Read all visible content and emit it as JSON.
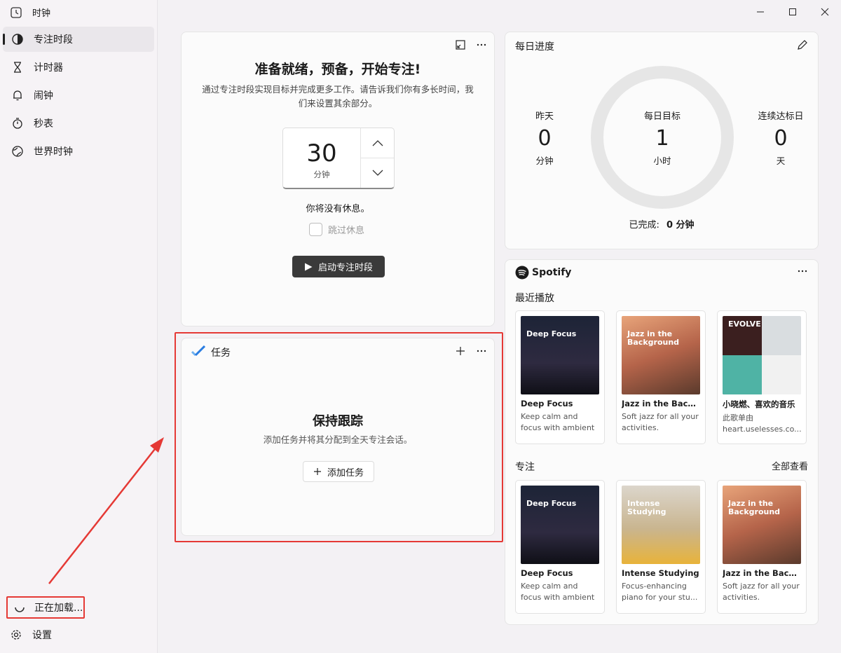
{
  "app": {
    "title": "时钟"
  },
  "sidebar": {
    "items": [
      {
        "label": "专注时段",
        "icon": "focus-icon",
        "active": true
      },
      {
        "label": "计时器",
        "icon": "hourglass-icon"
      },
      {
        "label": "闹钟",
        "icon": "bell-icon"
      },
      {
        "label": "秒表",
        "icon": "stopwatch-icon"
      },
      {
        "label": "世界时钟",
        "icon": "globe-icon"
      }
    ],
    "loading_label": "正在加载...",
    "settings_label": "设置"
  },
  "focus": {
    "title": "准备就绪，预备，开始专注!",
    "description": "通过专注时段实现目标并完成更多工作。请告诉我们你有多长时间，我们来设置其余部分。",
    "minutes": "30",
    "unit": "分钟",
    "no_break": "你将没有休息。",
    "skip_break": "跳过休息",
    "start_label": "启动专注时段"
  },
  "tasks": {
    "title": "任务",
    "empty_title": "保持跟踪",
    "empty_desc": "添加任务并将其分配到全天专注会话。",
    "add_label": "添加任务"
  },
  "daily": {
    "title": "每日进度",
    "yesterday_label": "昨天",
    "yesterday_value": "0",
    "yesterday_unit": "分钟",
    "goal_label": "每日目标",
    "goal_value": "1",
    "goal_unit": "小时",
    "streak_label": "连续达标日",
    "streak_value": "0",
    "streak_unit": "天",
    "completed_label": "已完成:",
    "completed_value": "0 分钟"
  },
  "spotify": {
    "brand": "Spotify",
    "recent_title": "最近播放",
    "focus_title": "专注",
    "view_all": "全部查看",
    "recent": [
      {
        "title": "Deep Focus",
        "desc": "Keep calm and focus with ambient and...",
        "cover_text": "Deep Focus"
      },
      {
        "title": "Jazz in the Backg...",
        "desc": "Soft jazz for all your activities.",
        "cover_text": "Jazz in the Background"
      },
      {
        "title": "小晓燃、喜欢的音乐",
        "desc": "此歌单由 heart.uselesses.co...",
        "cover_text": "EVOLVE"
      }
    ],
    "focus": [
      {
        "title": "Deep Focus",
        "desc": "Keep calm and focus with ambient and...",
        "cover_text": "Deep Focus"
      },
      {
        "title": "Intense Studying",
        "desc": "Focus-enhancing piano for your stu...",
        "cover_text": "Intense Studying"
      },
      {
        "title": "Jazz in the Backg...",
        "desc": "Soft jazz for all your activities.",
        "cover_text": "Jazz in the Background"
      }
    ]
  },
  "colors": {
    "annotation": "#e53935",
    "spotify_green": "#1db954",
    "todo_blue": "#2a7de1"
  }
}
